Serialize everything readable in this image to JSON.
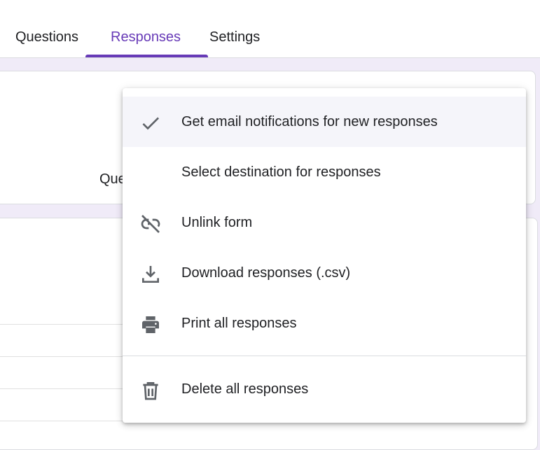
{
  "tabs": [
    {
      "label": "Questions",
      "active": false
    },
    {
      "label": "Responses",
      "active": true
    },
    {
      "label": "Settings",
      "active": false
    }
  ],
  "background": {
    "partial_label": "Que"
  },
  "menu": {
    "items": [
      {
        "label": "Get email notifications for new responses",
        "icon": "check-icon",
        "checked": true
      },
      {
        "label": "Select destination for responses",
        "icon": null
      },
      {
        "label": "Unlink form",
        "icon": "link-off-icon"
      },
      {
        "label": "Download responses (.csv)",
        "icon": "download-icon"
      },
      {
        "label": "Print all responses",
        "icon": "printer-icon"
      },
      {
        "label": "Delete all responses",
        "icon": "trash-icon"
      }
    ]
  },
  "colors": {
    "accent": "#673ab7",
    "background": "#f0ebf8",
    "icon": "#5f6368",
    "text": "#202124"
  }
}
